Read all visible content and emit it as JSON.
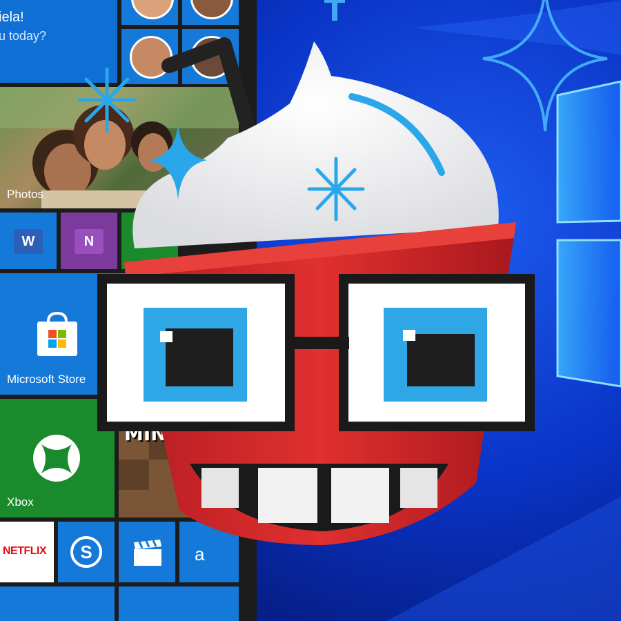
{
  "start_menu": {
    "greeting_line1": "iela!",
    "greeting_line2": "u today?",
    "tiles": {
      "photos": "Photos",
      "store": "Microsoft Store",
      "xbox": "Xbox",
      "minecraft": "MINE",
      "netflix": "NETFLIX",
      "word_glyph": "W",
      "onenote_glyph": "N",
      "translator_glyph": "a"
    }
  },
  "colors": {
    "tile_blue": "#1479d8",
    "tile_green": "#1a8a2c",
    "word_blue": "#2b5fb8",
    "onenote_purple": "#7b3a9c",
    "netflix_red": "#e50914",
    "mascot_red": "#d3262b",
    "accent_cyan": "#29a7ea"
  },
  "icons": [
    "person-avatar-icon",
    "word-icon",
    "onenote-icon",
    "store-bag-icon",
    "xbox-logo-icon",
    "skype-icon",
    "movies-clapper-icon",
    "translator-icon",
    "windows-logo-icon",
    "sparkle-icon"
  ]
}
